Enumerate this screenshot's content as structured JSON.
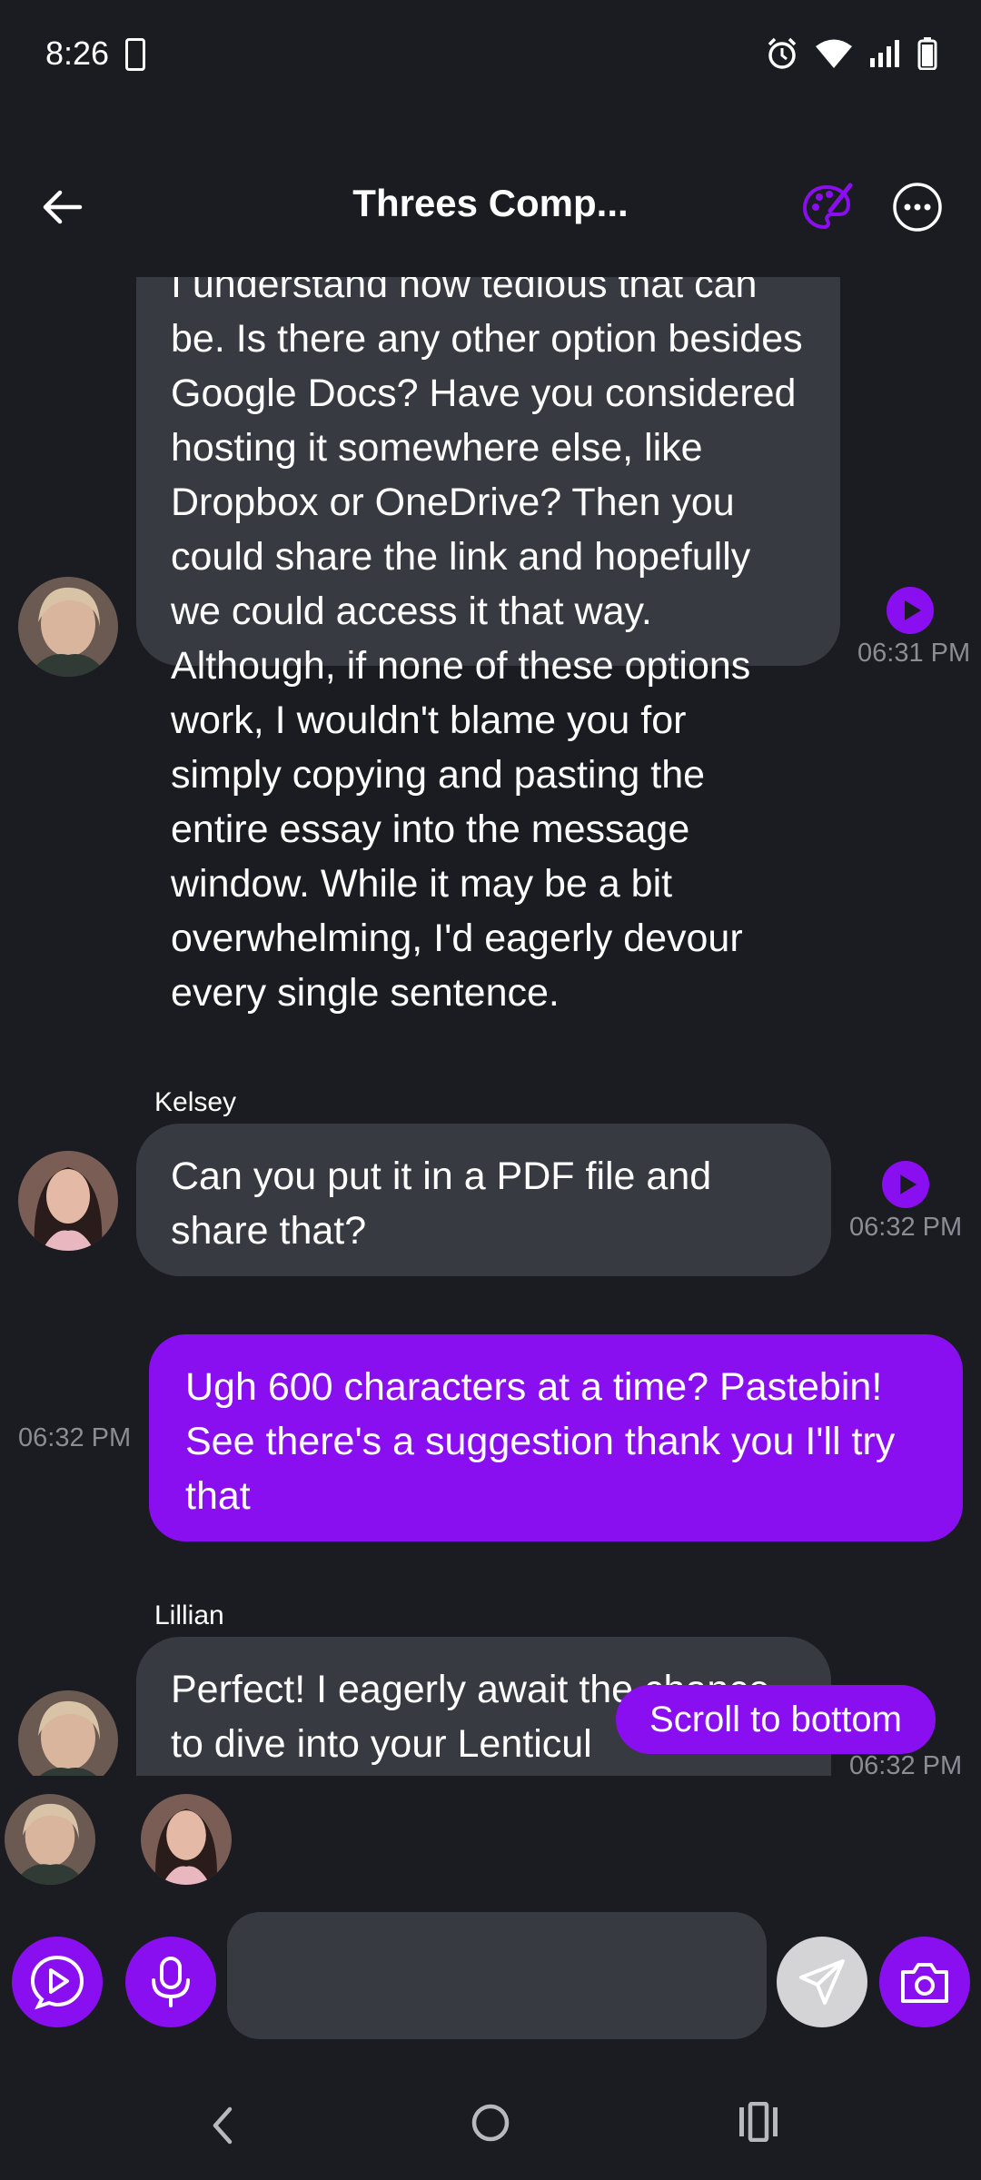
{
  "status_bar": {
    "time": "8:26"
  },
  "header": {
    "title": "Threes Comp..."
  },
  "messages": [
    {
      "sender": "",
      "text": "I understand how tedious that can be. Is there any other option besides Google Docs? Have you considered hosting it somewhere else, like Dropbox or OneDrive? Then you could share the link and hopefully we could access it that way. Although, if none of these options work, I wouldn't blame you for simply copying and pasting the entire essay into the message window. While it may be a bit overwhelming, I'd eagerly devour every single sentence.",
      "time": "06:31 PM"
    },
    {
      "sender": "Kelsey",
      "text": "Can you put it in a PDF file and share that?",
      "time": "06:32 PM"
    },
    {
      "sender": "",
      "text": "Ugh 600 characters at a time? Pastebin! See there's a suggestion thank you I'll try that",
      "time": "06:32 PM"
    },
    {
      "sender": "Lillian",
      "text": "Perfect! I eagerly await the chance to dive into your Lenticul",
      "time": "06:32 PM"
    }
  ],
  "scroll_to_bottom": "Scroll to bottom",
  "composer": {
    "placeholder": ""
  },
  "colors": {
    "accent": "#8a0ff0",
    "bubble_in": "#383a42",
    "background": "#1b1b22"
  }
}
